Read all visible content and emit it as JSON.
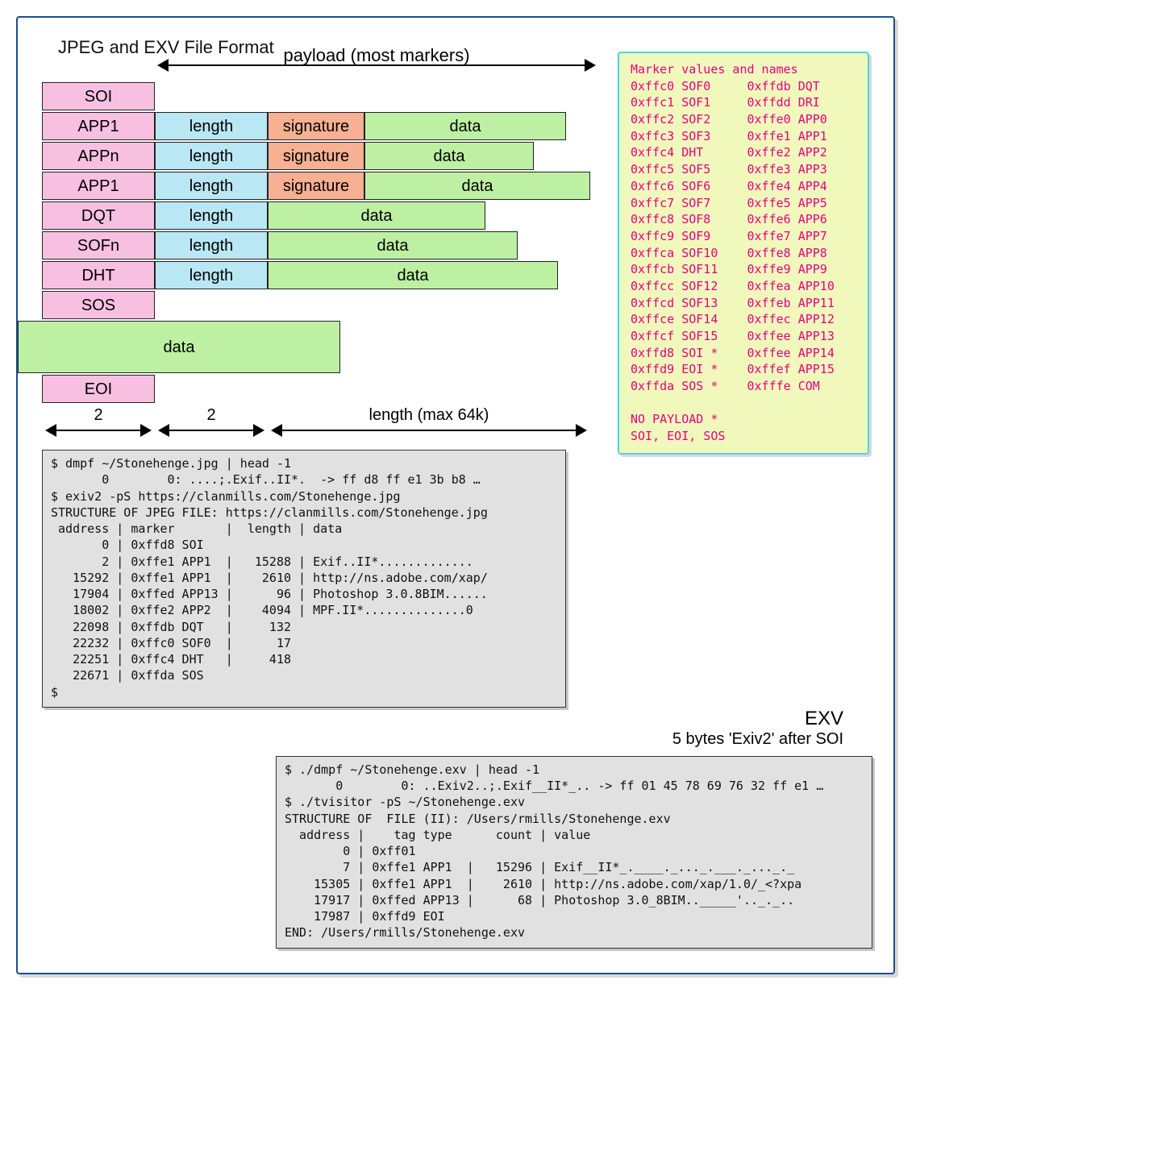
{
  "title": "JPEG and EXV File Format",
  "payload_label": "payload (most markers)",
  "rows": [
    {
      "marker": "SOI"
    },
    {
      "marker": "APP1",
      "length": "length",
      "sig": "signature",
      "data": "data",
      "dw": 250
    },
    {
      "marker": "APPn",
      "length": "length",
      "sig": "signature",
      "data": "data",
      "dw": 210
    },
    {
      "marker": "APP1",
      "length": "length",
      "sig": "signature",
      "data": "data",
      "dw": 280
    },
    {
      "marker": "DQT",
      "length": "length",
      "data": "data",
      "dw": 270
    },
    {
      "marker": "SOFn",
      "length": "length",
      "data": "data",
      "dw": 310
    },
    {
      "marker": "DHT",
      "length": "length",
      "data": "data",
      "dw": 360
    },
    {
      "marker": "SOS"
    }
  ],
  "bigdata": "data",
  "eoi": "EOI",
  "bottom": {
    "col1": "2",
    "col2": "2",
    "col3": "length (max 64k)"
  },
  "marker_table": {
    "heading": "Marker values and names",
    "left": [
      "0xffc0 SOF0",
      "0xffc1 SOF1",
      "0xffc2 SOF2",
      "0xffc3 SOF3",
      "0xffc4 DHT",
      "0xffc5 SOF5",
      "0xffc6 SOF6",
      "0xffc7 SOF7",
      "0xffc8 SOF8",
      "0xffc9 SOF9",
      "0xffca SOF10",
      "0xffcb SOF11",
      "0xffcc SOF12",
      "0xffcd SOF13",
      "0xffce SOF14",
      "0xffcf SOF15",
      "0xffd8 SOI *",
      "0xffd9 EOI *",
      "0xffda SOS *"
    ],
    "right": [
      "0xffdb DQT",
      "0xffdd DRI",
      "0xffe0 APP0",
      "0xffe1 APP1",
      "0xffe2 APP2",
      "0xffe3 APP3",
      "0xffe4 APP4",
      "0xffe5 APP5",
      "0xffe6 APP6",
      "0xffe7 APP7",
      "0xffe8 APP8",
      "0xffe9 APP9",
      "0xffea APP10",
      "0xffeb APP11",
      "0xffec APP12",
      "0xffee APP13",
      "0xffee APP14",
      "0xffef APP15",
      "0xfffe COM"
    ],
    "footer1": "NO PAYLOAD *",
    "footer2": "SOI, EOI, SOS"
  },
  "term1": "$ dmpf ~/Stonehenge.jpg | head -1\n       0        0: ....;.Exif..II*.  -> ff d8 ff e1 3b b8 …\n$ exiv2 -pS https://clanmills.com/Stonehenge.jpg\nSTRUCTURE OF JPEG FILE: https://clanmills.com/Stonehenge.jpg\n address | marker       |  length | data\n       0 | 0xffd8 SOI\n       2 | 0xffe1 APP1  |   15288 | Exif..II*.............\n   15292 | 0xffe1 APP1  |    2610 | http://ns.adobe.com/xap/\n   17904 | 0xffed APP13 |      96 | Photoshop 3.0.8BIM......\n   18002 | 0xffe2 APP2  |    4094 | MPF.II*..............0\n   22098 | 0xffdb DQT   |     132\n   22232 | 0xffc0 SOF0  |      17\n   22251 | 0xffc4 DHT   |     418\n   22671 | 0xffda SOS\n$",
  "exv_label": "EXV",
  "exv_sub": "5 bytes 'Exiv2' after SOI",
  "term2": "$ ./dmpf ~/Stonehenge.exv | head -1\n       0        0: ..Exiv2..;.Exif__II*_.. -> ff 01 45 78 69 76 32 ff e1 …\n$ ./tvisitor -pS ~/Stonehenge.exv\nSTRUCTURE OF  FILE (II): /Users/rmills/Stonehenge.exv\n  address |    tag type      count | value\n        0 | 0xff01\n        7 | 0xffe1 APP1  |   15296 | Exif__II*_.____._..._.___._..._._\n    15305 | 0xffe1 APP1  |    2610 | http://ns.adobe.com/xap/1.0/_<?xpa\n    17917 | 0xffed APP13 |      68 | Photoshop 3.0_8BIM.._____'.._._..\n    17987 | 0xffd9 EOI\nEND: /Users/rmills/Stonehenge.exv"
}
